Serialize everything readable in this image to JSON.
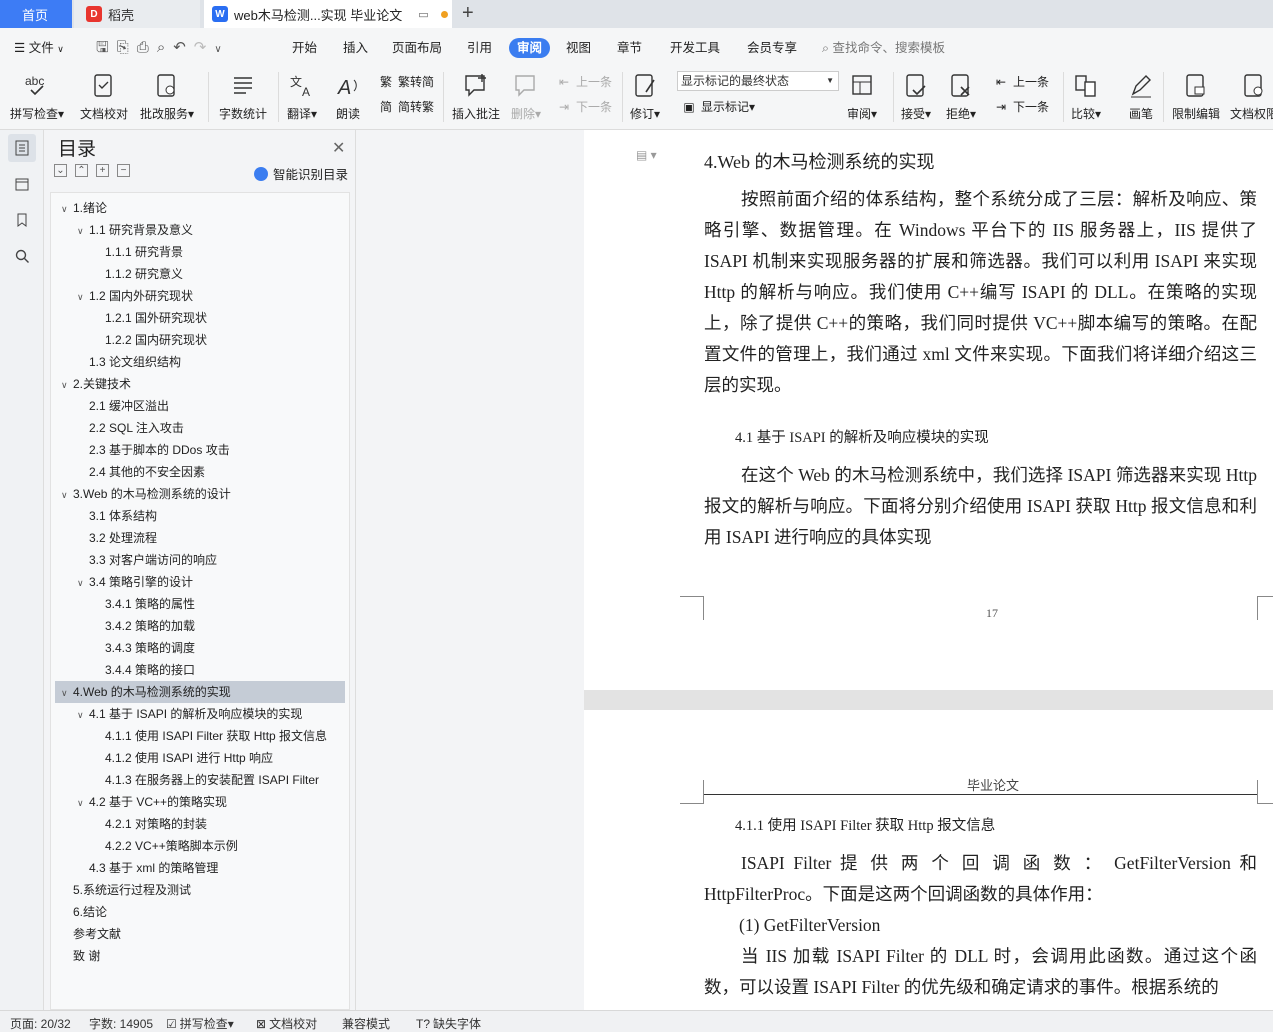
{
  "tabs": {
    "home": "首页",
    "daoke": "稻壳",
    "doc": "web木马检测...实现 毕业论文"
  },
  "menu": {
    "file": "文件",
    "items": [
      "开始",
      "插入",
      "页面布局",
      "引用",
      "审阅",
      "视图",
      "章节",
      "开发工具",
      "会员专享"
    ],
    "search": "查找命令、搜索模板"
  },
  "ribbon": {
    "spell": "拼写检查",
    "doccheck": "文档校对",
    "batch": "批改服务",
    "wordcount": "字数统计",
    "translate": "翻译",
    "read": "朗读",
    "t2s": "繁转简",
    "s2t": "简转繁",
    "insert_comment": "插入批注",
    "delete": "删除",
    "prev": "上一条",
    "next": "下一条",
    "revise": "修订",
    "markup_state": "显示标记的最终状态",
    "show_markup": "显示标记",
    "review": "审阅",
    "accept": "接受",
    "reject": "拒绝",
    "prev2": "上一条",
    "next2": "下一条",
    "compare": "比较",
    "pen": "画笔",
    "restrict": "限制编辑",
    "docperm": "文档权限"
  },
  "toc": {
    "title": "目录",
    "smart": "智能识别目录",
    "items": [
      "1.绪论",
      "1.1  研究背景及意义",
      "1.1.1 研究背景",
      "1.1.2  研究意义",
      "1.2  国内外研究现状",
      "1.2.1  国外研究现状",
      "1.2.2  国内研究现状",
      "1.3  论文组织结构",
      "2.关键技术",
      "2.1 缓冲区溢出",
      "2.2 SQL 注入攻击",
      "2.3 基于脚本的 DDos 攻击",
      "2.4 其他的不安全因素",
      "3.Web 的木马检测系统的设计",
      "3.1 体系结构",
      "3.2 处理流程",
      "3.3 对客户端访问的响应",
      "3.4 策略引擎的设计",
      "3.4.1 策略的属性",
      "3.4.2 策略的加载",
      "3.4.3 策略的调度",
      "3.4.4 策略的接口",
      "4.Web 的木马检测系统的实现",
      "4.1 基于 ISAPI  的解析及响应模块的实现",
      "4.1.1 使用 ISAPI Filter 获取 Http 报文信息",
      "4.1.2 使用 ISAPI 进行 Http 响应",
      "4.1.3 在服务器上的安装配置 ISAPI Filter",
      "4.2 基于 VC++的策略实现",
      "4.2.1 对策略的封装",
      "4.2.2 VC++策略脚本示例",
      "4.3 基于 xml 的策略管理",
      "5.系统运行过程及测试",
      "6.结论",
      "参考文献",
      "致    谢"
    ]
  },
  "doc": {
    "h4": "4.Web 的木马检测系统的实现",
    "p1": "按照前面介绍的体系结构，整个系统分成了三层：解析及响应、策略引擎、数据管理。在 Windows 平台下的 IIS 服务器上，IIS 提供了 ISAPI 机制来实现服务器的扩展和筛选器。我们可以利用 ISAPI 来实现 Http 的解析与响应。我们使用 C++编写 ISAPI 的 DLL。在策略的实现上，除了提供 C++的策略，我们同时提供 VC++脚本编写的策略。在配置文件的管理上，我们通过 xml 文件来实现。下面我们将详细介绍这三层的实现。",
    "h41": "4.1 基于 ISAPI  的解析及响应模块的实现",
    "p2": "在这个 Web 的木马检测系统中，我们选择 ISAPI 筛选器来实现 Http 报文的解析与响应。下面将分别介绍使用 ISAPI 获取 Http 报文信息和利用 ISAPI 进行响应的具体实现",
    "pagenum": "17",
    "header": "毕业论文",
    "h411": "4.1.1 使用 ISAPI Filter 获取 Http 报文信息",
    "p3": "ISAPI  Filter  提 供 两 个 回 调 函 数 ： GetFilterVersion  和 HttpFilterProc。下面是这两个回调函数的具体作用：",
    "p4": "(1) GetFilterVersion",
    "p5": "当 IIS 加载 ISAPI Filter 的 DLL 时，会调用此函数。通过这个函数，可以设置 ISAPI Filter 的优先级和确定请求的事件。根据系统的"
  },
  "status": {
    "page": "页面: 20/32",
    "words": "字数: 14905",
    "spell": "拼写检查",
    "doccheck": "文档校对",
    "compat": "兼容模式",
    "font": "缺失字体"
  },
  "colors": {
    "accent": "#3b7df0",
    "selected": "#c5ccd6"
  }
}
